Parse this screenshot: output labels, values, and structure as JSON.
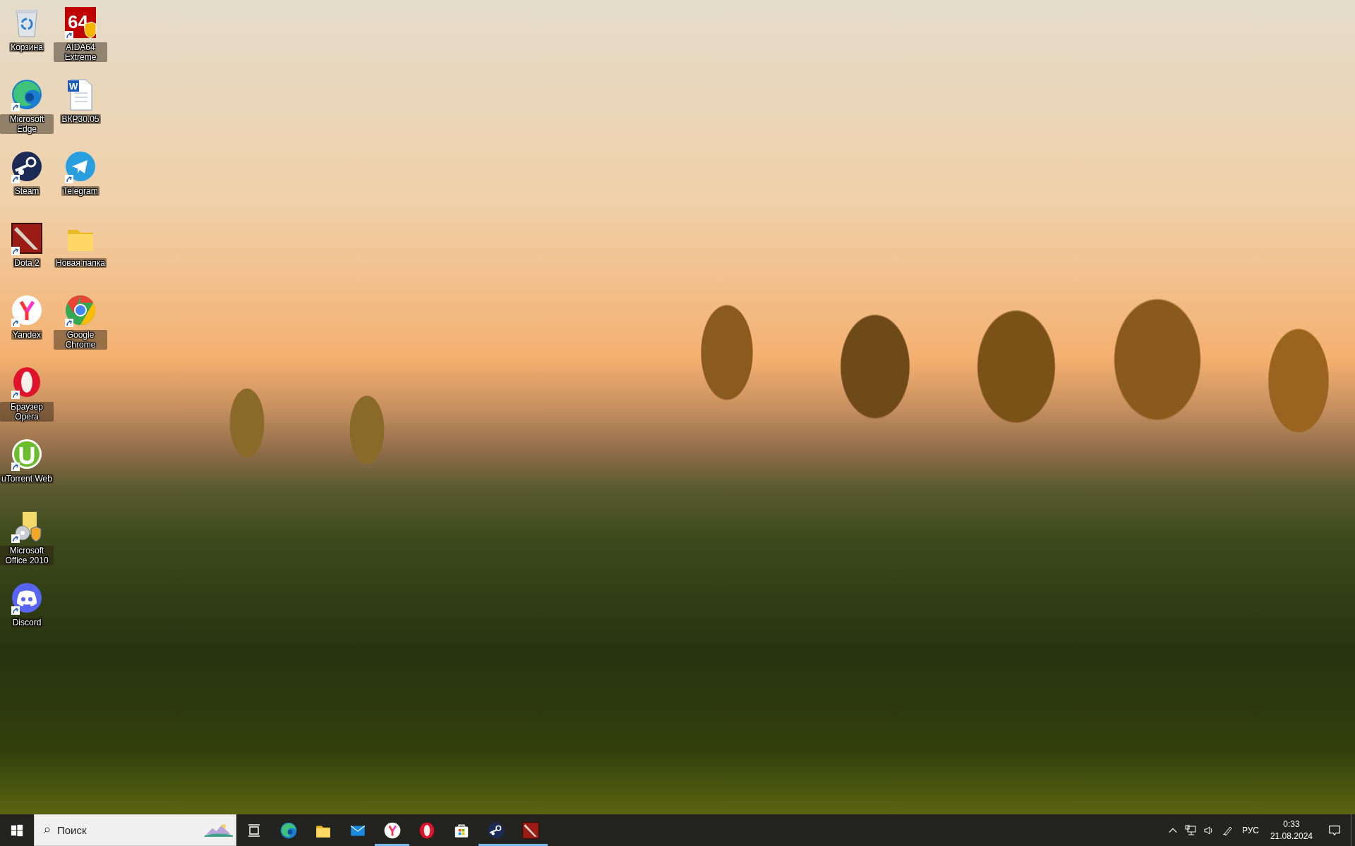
{
  "desktop": {
    "columns": [
      {
        "icons": [
          {
            "kind": "recycle-bin",
            "label": "Корзина",
            "shortcut": false
          },
          {
            "kind": "edge",
            "label": "Microsoft Edge",
            "shortcut": true
          },
          {
            "kind": "steam",
            "label": "Steam",
            "shortcut": true
          },
          {
            "kind": "dota",
            "label": "Dota 2",
            "shortcut": true
          },
          {
            "kind": "yandex",
            "label": "Yandex",
            "shortcut": true
          },
          {
            "kind": "opera",
            "label": "Браузер Opera",
            "shortcut": true
          },
          {
            "kind": "utorrent",
            "label": "uTorrent Web",
            "shortcut": true
          },
          {
            "kind": "office",
            "label": "Microsoft Office 2010",
            "shortcut": true
          },
          {
            "kind": "discord",
            "label": "Discord",
            "shortcut": true
          }
        ]
      },
      {
        "icons": [
          {
            "kind": "aida",
            "label": "AIDA64 Extreme",
            "shortcut": true,
            "logo_text": "64"
          },
          {
            "kind": "word-doc",
            "label": "ВКР30.05",
            "shortcut": false,
            "logo_text": "W"
          },
          {
            "kind": "telegram",
            "label": "Telegram",
            "shortcut": true
          },
          {
            "kind": "folder",
            "label": "Новая папка",
            "shortcut": false
          },
          {
            "kind": "chrome",
            "label": "Google Chrome",
            "shortcut": true
          }
        ]
      }
    ]
  },
  "taskbar": {
    "search": {
      "placeholder": "Поиск"
    },
    "apps": [
      {
        "kind": "edge",
        "running": false
      },
      {
        "kind": "explorer",
        "running": false
      },
      {
        "kind": "mail",
        "running": false
      },
      {
        "kind": "yandex",
        "running": true
      },
      {
        "kind": "opera",
        "running": false
      },
      {
        "kind": "store",
        "running": false
      },
      {
        "kind": "steam",
        "running": true
      },
      {
        "kind": "dota",
        "running": true
      }
    ],
    "tray": {
      "language": "РУС",
      "time": "0:33",
      "date": "21.08.2024"
    }
  }
}
